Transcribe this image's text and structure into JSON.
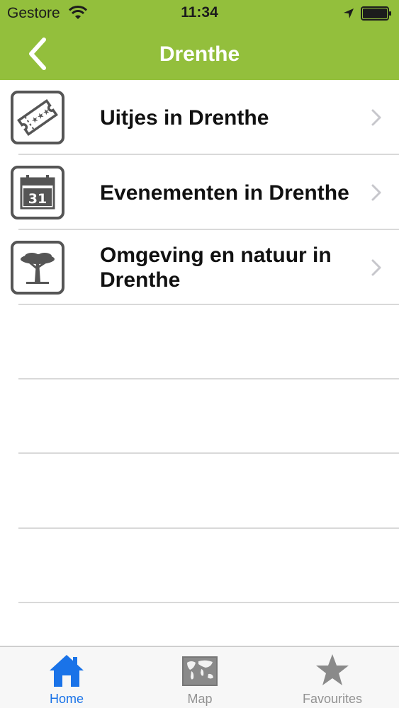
{
  "status_bar": {
    "carrier": "Gestore",
    "time": "11:34",
    "icons": [
      "wifi-icon",
      "location-arrow-icon",
      "battery-icon"
    ]
  },
  "nav": {
    "title": "Drenthe",
    "back_icon": "chevron-left-icon"
  },
  "list": {
    "items": [
      {
        "label": "Uitjes in Drenthe",
        "icon": "ticket-icon"
      },
      {
        "label": "Evenementen in Drenthe",
        "icon": "calendar-icon",
        "icon_text": "31"
      },
      {
        "label": "Omgeving en natuur in Drenthe",
        "icon": "tree-icon"
      }
    ]
  },
  "tab_bar": {
    "tabs": [
      {
        "label": "Home",
        "icon": "home-icon",
        "active": true
      },
      {
        "label": "Map",
        "icon": "map-icon",
        "active": false
      },
      {
        "label": "Favourites",
        "icon": "star-icon",
        "active": false
      }
    ]
  },
  "colors": {
    "header_bg": "#93bf3c",
    "active_tab": "#1a73e8",
    "inactive_tab": "#929292",
    "icon_gray": "#555555"
  }
}
